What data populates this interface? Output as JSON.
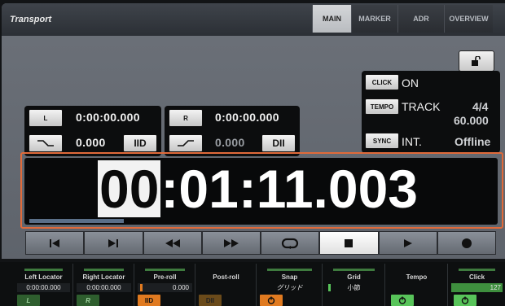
{
  "window": {
    "title": "Transport"
  },
  "tabs": [
    {
      "label": "MAIN",
      "active": true
    },
    {
      "label": "MARKER",
      "active": false
    },
    {
      "label": "ADR",
      "active": false
    },
    {
      "label": "OVERVIEW",
      "active": false
    }
  ],
  "lock": {
    "icon": "unlock-icon"
  },
  "locators": {
    "left_button": "L",
    "left_time": "0:00:00.000",
    "right_button": "R",
    "right_time": "0:00:00.000",
    "fade_in_value": "0.000",
    "fade_out_value": "0.000",
    "preroll_icon": "IID",
    "postroll_icon": "DII"
  },
  "right_panel": {
    "click_label": "CLICK",
    "click_value": "ON",
    "tempo_label": "TEMPO",
    "tempo_mode": "TRACK",
    "meter": "4/4",
    "bpm": "60.000",
    "sync_label": "SYNC",
    "sync_source": "INT.",
    "sync_status": "Offline"
  },
  "counter": {
    "hours": "00",
    "rest": ":01:11.003",
    "progress": 0.2
  },
  "transport": [
    {
      "name": "go-to-start-icon",
      "glyph": "start"
    },
    {
      "name": "go-to-end-icon",
      "glyph": "end"
    },
    {
      "name": "rewind-icon",
      "glyph": "rew"
    },
    {
      "name": "fast-forward-icon",
      "glyph": "ff"
    },
    {
      "name": "loop-icon",
      "glyph": "loop"
    },
    {
      "name": "stop-icon",
      "glyph": "stop"
    },
    {
      "name": "play-icon",
      "glyph": "play"
    },
    {
      "name": "record-icon",
      "glyph": "rec"
    }
  ],
  "footer": [
    {
      "label": "Left Locator",
      "value": "0:00:00.000",
      "bottom": "L"
    },
    {
      "label": "Right Locator",
      "value": "0:00:00.000",
      "bottom": "R"
    },
    {
      "label": "Pre-roll",
      "value": "0.000",
      "bottom": "IID"
    },
    {
      "label": "Post-roll",
      "value": "",
      "bottom": "DII"
    },
    {
      "label": "Snap",
      "value": "グリッド",
      "bottom": "power"
    },
    {
      "label": "Grid",
      "value": "小節",
      "bottom": ""
    },
    {
      "label": "Tempo",
      "value": "",
      "bottom": "power"
    },
    {
      "label": "Click",
      "value": "127",
      "bottom": "power"
    }
  ],
  "colors": {
    "accent": "#e06a3a",
    "green": "#3e7a3e",
    "orange": "#e07a20"
  }
}
